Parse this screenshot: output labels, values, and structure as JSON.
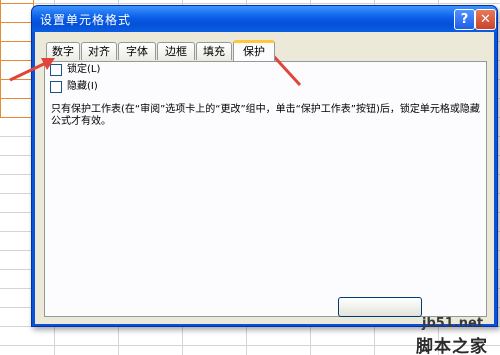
{
  "dialog": {
    "title": "设置单元格格式",
    "help_label": "?",
    "close_label": "✕",
    "tabs": [
      {
        "label": "数字"
      },
      {
        "label": "对齐"
      },
      {
        "label": "字体"
      },
      {
        "label": "边框"
      },
      {
        "label": "填充"
      },
      {
        "label": "保护"
      }
    ],
    "active_tab": "保护",
    "protection": {
      "locked_label": "锁定(L)",
      "locked_checked": false,
      "hidden_label": "隐藏(I)",
      "hidden_checked": false,
      "description": "只有保护工作表(在“审阅”选项卡上的“更改”组中，单击“保护工作表”按钮)后，锁定单元格或隐藏公式才有效。"
    }
  },
  "watermark": {
    "site": "jb51.net",
    "brand": "脚本之家"
  },
  "colors": {
    "annotation_arrow": "#e0443a",
    "title_bar": "#0a5ee8",
    "active_tab_accent": "#ffc83c",
    "dialog_face": "#ece9d8"
  }
}
